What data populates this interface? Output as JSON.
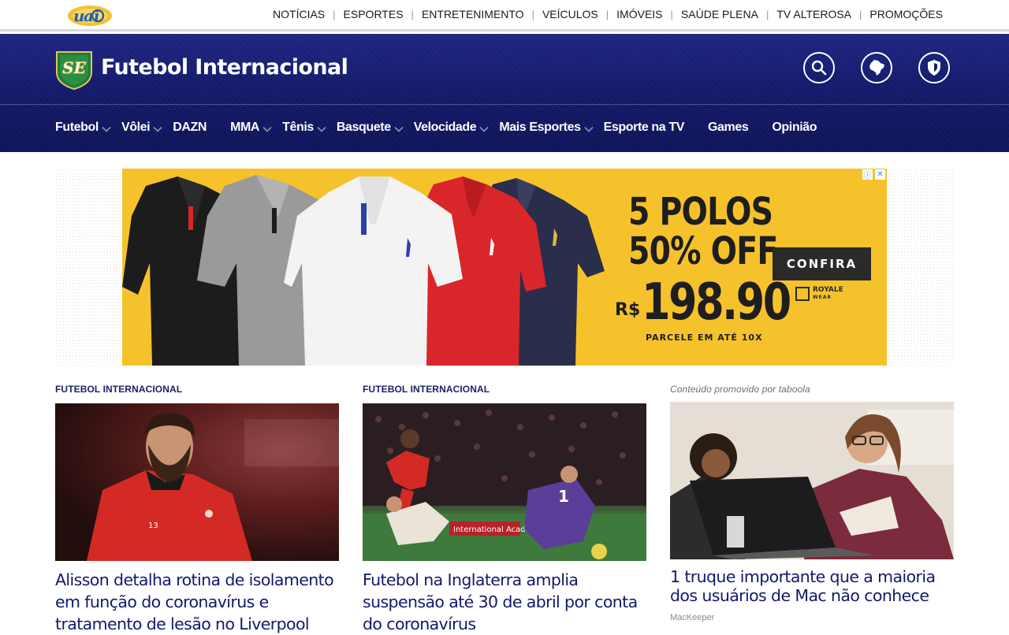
{
  "portal": {
    "nav": [
      "NOTÍCIAS",
      "ESPORTES",
      "ENTRETENIMENTO",
      "VEÍCULOS",
      "IMÓVEIS",
      "SAÚDE PLENA",
      "TV ALTEROSA",
      "PROMOÇÕES"
    ]
  },
  "header": {
    "section_title": "Futebol Internacional",
    "nav": [
      {
        "label": "Futebol",
        "dropdown": true
      },
      {
        "label": "Vôlei",
        "dropdown": true
      },
      {
        "label": "DAZN",
        "dropdown": false
      },
      {
        "label": "MMA",
        "dropdown": true
      },
      {
        "label": "Tênis",
        "dropdown": true
      },
      {
        "label": "Basquete",
        "dropdown": true
      },
      {
        "label": "Velocidade",
        "dropdown": true
      },
      {
        "label": "Mais Esportes",
        "dropdown": true
      },
      {
        "label": "Esporte na TV",
        "dropdown": false
      },
      {
        "label": "Games",
        "dropdown": false
      },
      {
        "label": "Opinião",
        "dropdown": false
      }
    ],
    "icons": [
      "search-icon",
      "brazil-map-icon",
      "shield-icon"
    ],
    "colors": {
      "header_bg": "#151a6b",
      "accent": "#12196b"
    }
  },
  "ad": {
    "headline_line1": "5 POLOS",
    "headline_line2": "50% OFF",
    "currency": "R$",
    "price": "198.90",
    "installments": "PARCELE EM ATÉ 10X",
    "cta": "CONFIRA",
    "brand": "ROYALE",
    "brand_sub": "WEAR",
    "info_icon": "ⓘ",
    "close_icon": "✕",
    "bg_color": "#f6c22c"
  },
  "cards": [
    {
      "kicker": "FUTEBOL INTERNACIONAL",
      "title": "Alisson detalha rotina de isolamento em função do coronavírus e tratamento de lesão no Liverpool",
      "shirt_number": "13"
    },
    {
      "kicker": "FUTEBOL INTERNACIONAL",
      "title": "Futebol na Inglaterra amplia suspensão até 30 de abril por conta do coronavírus",
      "board_text": "International Academy",
      "shirt_number": "1"
    },
    {
      "kicker": "Conteúdo promovido por taboola",
      "title": "1 truque importante que a maioria dos usuários de Mac não conhece",
      "source": "MacKeeper"
    }
  ]
}
